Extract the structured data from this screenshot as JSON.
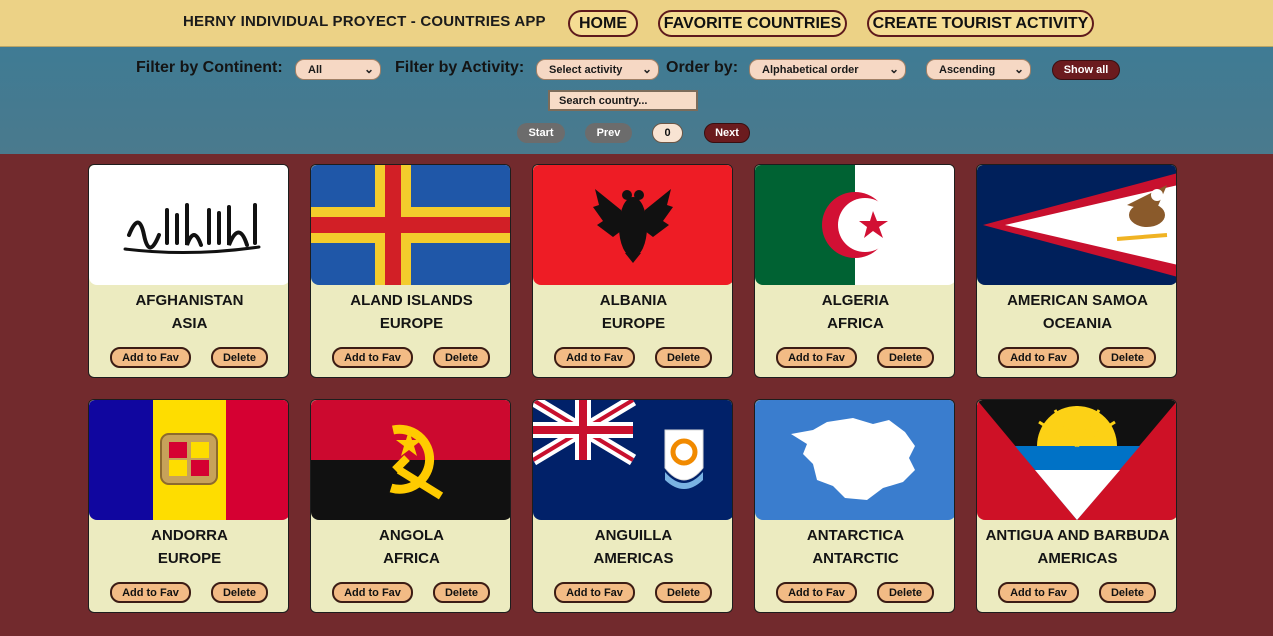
{
  "header": {
    "title": "HERNY INDIVIDUAL PROYECT - COUNTRIES APP",
    "nav": [
      "HOME",
      "FAVORITE COUNTRIES",
      "CREATE TOURIST ACTIVITY"
    ]
  },
  "filters": {
    "continent_label": "Filter by Continent:",
    "continent_value": "All",
    "activity_label": "Filter by Activity:",
    "activity_value": "Select activity",
    "order_label": "Order by:",
    "order_value": "Alphabetical order",
    "direction_value": "Ascending",
    "show_all": "Show all",
    "search_placeholder": "Search country..."
  },
  "pagination": {
    "start": "Start",
    "prev": "Prev",
    "page": "0",
    "next": "Next"
  },
  "card_actions": {
    "fav": "Add to Fav",
    "delete": "Delete"
  },
  "countries": [
    {
      "name": "AFGHANISTAN",
      "continent": "ASIA",
      "flag": "afghanistan-flag-icon"
    },
    {
      "name": "ALAND ISLANDS",
      "continent": "EUROPE",
      "flag": "aland-islands-flag-icon"
    },
    {
      "name": "ALBANIA",
      "continent": "EUROPE",
      "flag": "albania-flag-icon"
    },
    {
      "name": "ALGERIA",
      "continent": "AFRICA",
      "flag": "algeria-flag-icon"
    },
    {
      "name": "AMERICAN SAMOA",
      "continent": "OCEANIA",
      "flag": "american-samoa-flag-icon"
    },
    {
      "name": "ANDORRA",
      "continent": "EUROPE",
      "flag": "andorra-flag-icon"
    },
    {
      "name": "ANGOLA",
      "continent": "AFRICA",
      "flag": "angola-flag-icon"
    },
    {
      "name": "ANGUILLA",
      "continent": "AMERICAS",
      "flag": "anguilla-flag-icon"
    },
    {
      "name": "ANTARCTICA",
      "continent": "ANTARCTIC",
      "flag": "antarctica-flag-icon"
    },
    {
      "name": "ANTIGUA AND BARBUDA",
      "continent": "AMERICAS",
      "flag": "antigua-and-barbuda-flag-icon"
    }
  ],
  "colors": {
    "header_bg": "#ecd286",
    "filter_bg": "#3f7b94",
    "page_bg": "#722a2d",
    "card_bg": "#ecebc0",
    "button_bg": "#f2bb85"
  }
}
